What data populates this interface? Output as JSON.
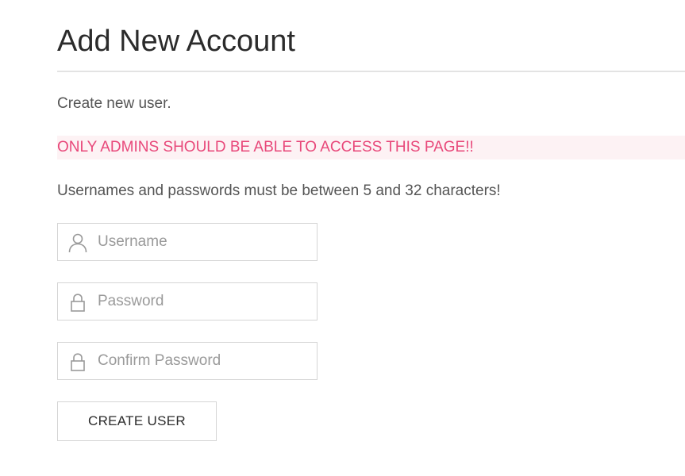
{
  "header": {
    "title": "Add New Account"
  },
  "content": {
    "intro": "Create new user.",
    "warning": "ONLY ADMINS SHOULD BE ABLE TO ACCESS THIS PAGE!!",
    "rules": "Usernames and passwords must be between 5 and 32 characters!"
  },
  "form": {
    "username": {
      "placeholder": "Username",
      "value": "",
      "icon": "user-icon"
    },
    "password": {
      "placeholder": "Password",
      "value": "",
      "icon": "lock-icon"
    },
    "confirm_password": {
      "placeholder": "Confirm Password",
      "value": "",
      "icon": "lock-icon"
    },
    "submit_label": "CREATE USER"
  },
  "colors": {
    "warning_text": "#e8487a",
    "warning_background": "#fdf2f4",
    "border": "#d5d5d5"
  }
}
